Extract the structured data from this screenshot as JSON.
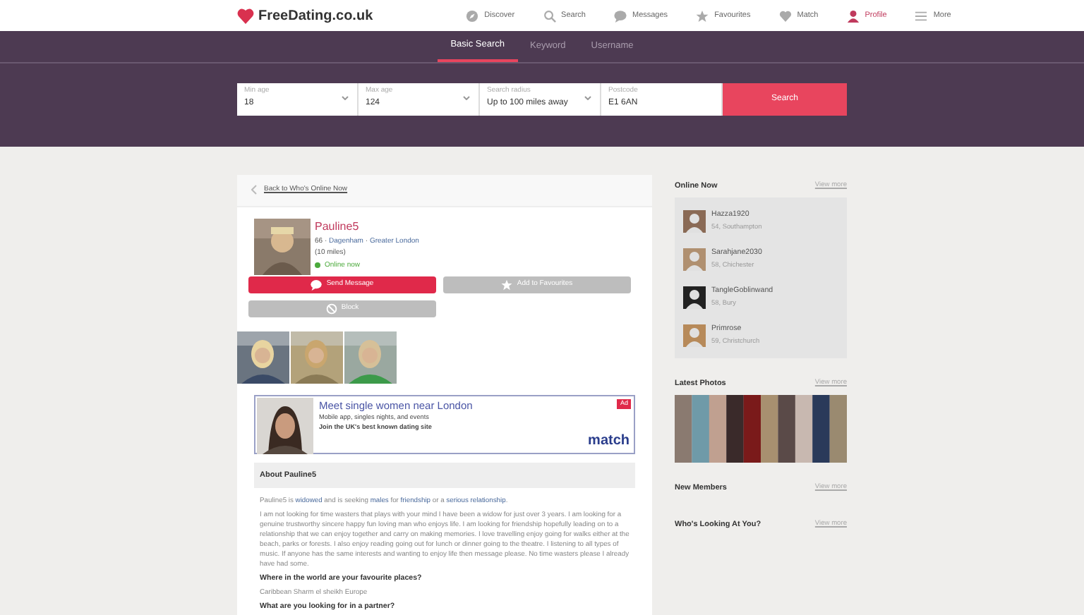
{
  "logo": {
    "text": "FreeDating.co.uk"
  },
  "nav": [
    {
      "label": "Discover",
      "selected": false
    },
    {
      "label": "Search",
      "selected": false
    },
    {
      "label": "Messages",
      "selected": false
    },
    {
      "label": "Favourites",
      "selected": false
    },
    {
      "label": "Match",
      "selected": false
    },
    {
      "label": "Profile",
      "selected": true
    },
    {
      "label": "More",
      "selected": false
    }
  ],
  "search_tabs": [
    {
      "label": "Basic Search",
      "selected": true
    },
    {
      "label": "Keyword",
      "selected": false
    },
    {
      "label": "Username",
      "selected": false
    }
  ],
  "search_fields": [
    {
      "label": "Min age",
      "value": "18",
      "kind": "select"
    },
    {
      "label": "Max age",
      "value": "124",
      "kind": "select"
    },
    {
      "label": "Search radius",
      "value": "Up to 100 miles away",
      "kind": "select"
    },
    {
      "label": "Postcode",
      "value": "E1 6AN",
      "kind": "text"
    }
  ],
  "search_button": "Search",
  "back_link": "Back to Who's Online Now",
  "profile": {
    "name": "Pauline5",
    "age": "66",
    "separator": "·",
    "town": "Dagenham",
    "region": "Greater London",
    "distance": "(10 miles)",
    "status": "Online now",
    "online": true
  },
  "actions": [
    {
      "label": "Send Message",
      "kind": "primary"
    },
    {
      "label": "Add to Favourites",
      "kind": "secondary"
    },
    {
      "label": "Block",
      "kind": "secondary"
    }
  ],
  "ad": {
    "title": "Meet single women near London",
    "line1": "Mobile app, singles nights, and events",
    "line2": "Join the UK's best known dating site",
    "badge": "Ad",
    "brand": "match"
  },
  "about": {
    "heading": "About Pauline5",
    "summary": "Pauline5 is **widowed** and is seeking **males** for **friendship** or a **serious relationship**.",
    "text": "I am not looking for time wasters that plays with your mind I have been a widow for just over 3 years. I am looking for a genuine trustworthy sincere happy fun loving man who enjoys life. I am looking for friendship hopefully leading on to a relationship that we can enjoy together and carry on making memories. I love travelling enjoy going for walks either at the beach, parks or forests. I also enjoy reading going out for lunch or dinner going to the theatre. I listening to all types of music. If anyone has the same interests and wanting to enjoy life then message please. No time wasters please I already have had some.",
    "questions": [
      {
        "question": "Where in the world are your favourite places?",
        "answer": "Caribbean Sharm el sheikh Europe"
      },
      {
        "question": "What are you looking for in a partner?"
      }
    ]
  },
  "sidebar": [
    {
      "title": "Online Now",
      "link": "View more",
      "kind": "members",
      "members": [
        {
          "name": "Hazza1920",
          "info": "54, Southampton"
        },
        {
          "name": "Sarahjane2030",
          "info": "58, Chichester"
        },
        {
          "name": "TangleGoblinwand",
          "info": "58, Bury"
        },
        {
          "name": "Primrose",
          "info": "59, Christchurch"
        }
      ]
    },
    {
      "title": "Latest Photos",
      "link": "View more",
      "kind": "photos"
    },
    {
      "title": "New Members",
      "link": "View more",
      "kind": "empty"
    },
    {
      "title": "Who's Looking At You?",
      "link": "View more",
      "kind": "empty"
    }
  ]
}
